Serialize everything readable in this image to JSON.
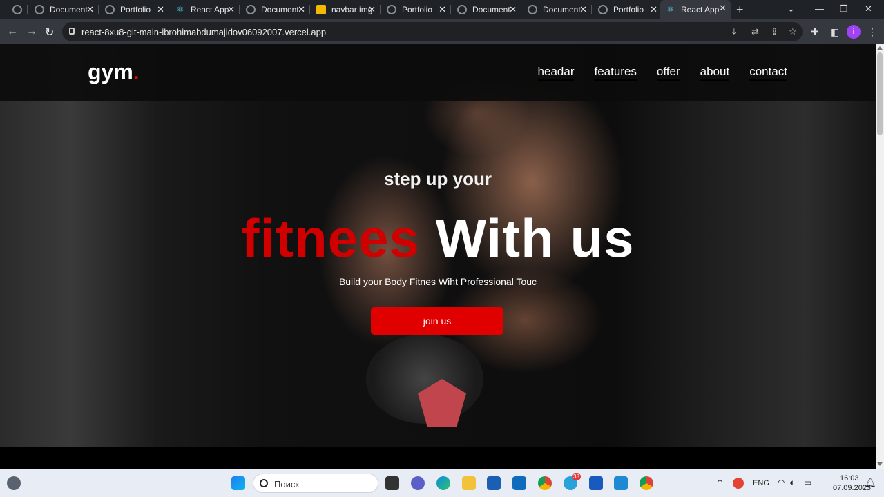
{
  "browser": {
    "tabs": [
      {
        "title": "",
        "favicon": "globe-icon"
      },
      {
        "title": "Document",
        "favicon": "globe-icon"
      },
      {
        "title": "Portfolio",
        "favicon": "globe-icon"
      },
      {
        "title": "React App",
        "favicon": "react-icon"
      },
      {
        "title": "Document",
        "favicon": "globe-icon"
      },
      {
        "title": "navbar img",
        "favicon": "image-icon"
      },
      {
        "title": "Portfolio",
        "favicon": "globe-icon"
      },
      {
        "title": "Document",
        "favicon": "globe-icon"
      },
      {
        "title": "Document",
        "favicon": "globe-icon"
      },
      {
        "title": "Portfolio",
        "favicon": "globe-icon"
      },
      {
        "title": "React App",
        "favicon": "react-icon",
        "active": true
      }
    ],
    "url": "react-8xu8-git-main-ibrohimabdumajidov06092007.vercel.app",
    "profile_initial": "i"
  },
  "site": {
    "logo": "gym",
    "logo_dot": ".",
    "nav": [
      "headar",
      "features",
      "offer",
      "about",
      "contact"
    ],
    "hero": {
      "subtitle": "step up your",
      "title_red": "fitnees",
      "title_white": "With us",
      "description": "Build your Body Fitnes Wiht Professional Touc",
      "cta": "join us"
    },
    "accent_color": "#e10000"
  },
  "taskbar": {
    "search_placeholder": "Поиск",
    "telegram_badge": "38",
    "language": "ENG",
    "time": "16:03",
    "date": "07.09.2023"
  }
}
